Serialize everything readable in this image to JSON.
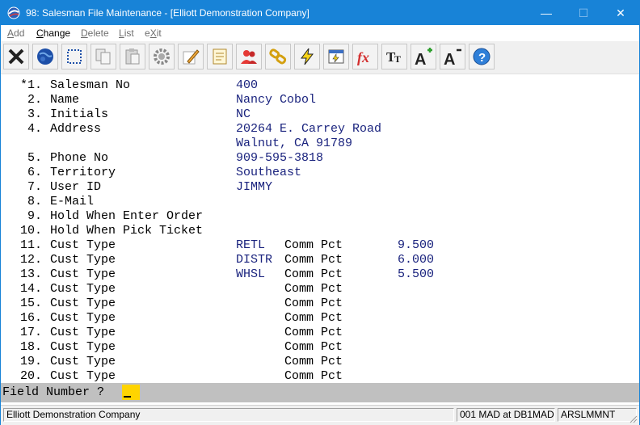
{
  "window": {
    "title": "98: Salesman File Maintenance - [Elliott Demonstration Company]",
    "controls": {
      "minimize": "—",
      "maximize": "☐",
      "close": "✕"
    }
  },
  "menu": [
    {
      "label": "Add",
      "enabled": false
    },
    {
      "label": "Change",
      "enabled": true
    },
    {
      "label": "Delete",
      "enabled": false
    },
    {
      "label": "List",
      "enabled": false
    },
    {
      "label": "eXit",
      "enabled": false
    }
  ],
  "toolbar": [
    {
      "name": "exit-icon"
    },
    {
      "name": "globe-icon"
    },
    {
      "name": "select-icon"
    },
    {
      "name": "copy-icon"
    },
    {
      "name": "paste-icon"
    },
    {
      "name": "settings-icon"
    },
    {
      "name": "edit-icon"
    },
    {
      "name": "notes-icon"
    },
    {
      "name": "users-icon"
    },
    {
      "name": "link-icon"
    },
    {
      "name": "lightning-icon"
    },
    {
      "name": "run-icon"
    },
    {
      "name": "function-icon"
    },
    {
      "name": "font-icon"
    },
    {
      "name": "font-increase-icon"
    },
    {
      "name": "font-decrease-icon"
    },
    {
      "name": "help-icon"
    }
  ],
  "fields": [
    {
      "num": "*1.",
      "label": "Salesman No",
      "value": "400"
    },
    {
      "num": "2.",
      "label": "Name",
      "value": "Nancy Cobol"
    },
    {
      "num": "3.",
      "label": "Initials",
      "value": "NC"
    },
    {
      "num": "4.",
      "label": "Address",
      "value": "20264 E. Carrey Road"
    },
    {
      "num": "",
      "label": "",
      "value": "Walnut, CA 91789"
    },
    {
      "num": "5.",
      "label": "Phone No",
      "value": "909-595-3818"
    },
    {
      "num": "6.",
      "label": "Territory",
      "value": "Southeast"
    },
    {
      "num": "7.",
      "label": "User ID",
      "value": "JIMMY"
    },
    {
      "num": "8.",
      "label": "E-Mail",
      "value": ""
    },
    {
      "num": "9.",
      "label": "Hold When Enter Order",
      "value": ""
    },
    {
      "num": "10.",
      "label": "Hold When Pick Ticket",
      "value": ""
    }
  ],
  "cust_types": [
    {
      "num": "11.",
      "label": "Cust Type",
      "type": "RETL",
      "comm_label": "Comm Pct",
      "pct": "9.500"
    },
    {
      "num": "12.",
      "label": "Cust Type",
      "type": "DISTR",
      "comm_label": "Comm Pct",
      "pct": "6.000"
    },
    {
      "num": "13.",
      "label": "Cust Type",
      "type": "WHSL",
      "comm_label": "Comm Pct",
      "pct": "5.500"
    },
    {
      "num": "14.",
      "label": "Cust Type",
      "type": "",
      "comm_label": "Comm Pct",
      "pct": ""
    },
    {
      "num": "15.",
      "label": "Cust Type",
      "type": "",
      "comm_label": "Comm Pct",
      "pct": ""
    },
    {
      "num": "16.",
      "label": "Cust Type",
      "type": "",
      "comm_label": "Comm Pct",
      "pct": ""
    },
    {
      "num": "17.",
      "label": "Cust Type",
      "type": "",
      "comm_label": "Comm Pct",
      "pct": ""
    },
    {
      "num": "18.",
      "label": "Cust Type",
      "type": "",
      "comm_label": "Comm Pct",
      "pct": ""
    },
    {
      "num": "19.",
      "label": "Cust Type",
      "type": "",
      "comm_label": "Comm Pct",
      "pct": ""
    },
    {
      "num": "20.",
      "label": "Cust Type",
      "type": "",
      "comm_label": "Comm Pct",
      "pct": ""
    }
  ],
  "prompt": {
    "label": "Field Number ?"
  },
  "status": {
    "company": "Elliott Demonstration Company",
    "server": "001 MAD at DB1MAD",
    "program": "ARSLMMNT"
  },
  "colors": {
    "titlebar": "#1883d7",
    "value_text": "#1a237e",
    "prompt_bar": "#c0c0c0",
    "cursor": "#ffd400"
  }
}
